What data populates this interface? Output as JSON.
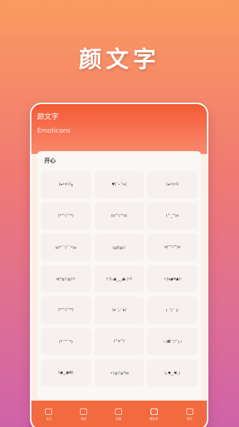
{
  "hero": {
    "title": "颜文字"
  },
  "phone": {
    "title": "颜文字",
    "subtitle": "Emoticons"
  },
  "section": {
    "title": "开心"
  },
  "emoticons": [
    "(๑•̀ㅂ•́)و",
    "♥(ˆ⌣ˆԅ)",
    "(๑•̀ㅂ•́)",
    "(*^▽^*)",
    "(o^▽^o)",
    "(^_^)v",
    "o(*￣▽￣*)o",
    "(≧∇≦)ﾉ",
    "o(^▽^)o",
    "o(*≧▽≦)ツ",
    "(づ｡◕‿‿◕｡)づ",
    "ヾ(o◕∀◕)ﾉ",
    "(*^▽^*)",
    "(๑¯◡¯๑)",
    "( ´▽` )ﾉ",
    "(*¯︶¯*)",
    "(^o^)",
    "ヽ(✿ﾟ▽ﾟ)ノ",
    "(◕‿◕✿)",
    "ヾ(≧▽≦*)o",
    "(｡♥‿♥｡)"
  ],
  "tabs": [
    {
      "label": "首页",
      "icon": "home-icon",
      "active": false
    },
    {
      "label": "表情",
      "icon": "face-icon",
      "active": false
    },
    {
      "label": "收藏",
      "icon": "star-icon",
      "active": false
    },
    {
      "label": "颜文字",
      "icon": "text-icon",
      "active": true
    },
    {
      "label": "我的",
      "icon": "user-icon",
      "active": false
    }
  ],
  "colors": {
    "accent": "#f26a3f",
    "header": "#f45a35"
  }
}
